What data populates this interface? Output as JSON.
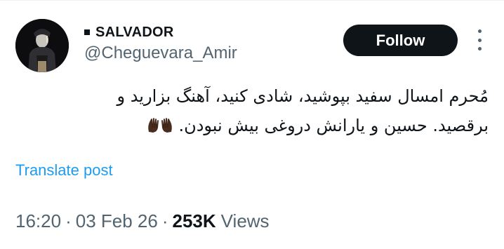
{
  "author": {
    "display_name": "SALVADOR",
    "handle": "@Cheguevara_Amir"
  },
  "actions": {
    "follow_label": "Follow"
  },
  "tweet": {
    "line1": "مُحرم امسال سفید بپوشید، شادی کنید، آهنگ بزارید و",
    "line2": "برقصید. حسین و یارانش دروغی بیش نبودن.",
    "emoji": "raised-hands-dark-skin"
  },
  "translate_label": "Translate post",
  "meta": {
    "time": "16:20",
    "separator": "·",
    "date": "03 Feb 26",
    "views_count": "253K",
    "views_label": "Views"
  },
  "colors": {
    "text": "#0f1419",
    "secondary": "#536471",
    "link": "#1d9bf0",
    "button_bg": "#0f1419"
  }
}
